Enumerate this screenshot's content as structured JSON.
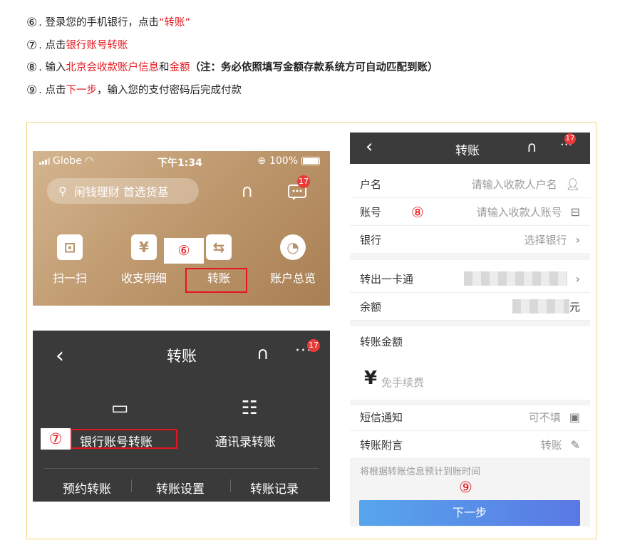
{
  "steps": [
    {
      "num": "⑥",
      "parts": [
        {
          "t": ". 登录您的手机银行，点击"
        },
        {
          "t": "“转账”",
          "red": true
        }
      ]
    },
    {
      "num": "⑦",
      "parts": [
        {
          "t": ". 点击"
        },
        {
          "t": "银行账号转账",
          "red": true
        }
      ]
    },
    {
      "num": "⑧",
      "parts": [
        {
          "t": ". 输入"
        },
        {
          "t": "北京会收款账户信息",
          "red": true
        },
        {
          "t": "和"
        },
        {
          "t": "金额",
          "red": true
        },
        {
          "t": "（注：务必依照填写金额存款系统方可自动匹配到账）",
          "bold": true
        }
      ]
    },
    {
      "num": "⑨",
      "parts": [
        {
          "t": ". 点击"
        },
        {
          "t": "下一步",
          "red": true
        },
        {
          "t": "，输入您的支付密码后完成付款"
        }
      ]
    }
  ],
  "screenA": {
    "carrier": "Globe",
    "time": "下午1:34",
    "battery": "100%",
    "battery_level": 1.0,
    "search_placeholder": "闲钱理财 首选货基",
    "badge": "17",
    "functions": [
      {
        "label": "扫一扫",
        "icon": "scan-icon"
      },
      {
        "label": "收支明细",
        "icon": "receipt-icon"
      },
      {
        "label": "转账",
        "icon": "transfer-icon"
      },
      {
        "label": "账户总览",
        "icon": "pie-chart-icon"
      }
    ],
    "annotation": "⑥"
  },
  "screenB": {
    "title": "转账",
    "badge": "17",
    "options": [
      {
        "label": "银行账号转账",
        "icon": "card-icon"
      },
      {
        "label": "通讯录转账",
        "icon": "contacts-icon"
      }
    ],
    "bottom": [
      "预约转账",
      "转账设置",
      "转账记录"
    ],
    "annotation": "⑦"
  },
  "screenC": {
    "title": "转账",
    "badge": "17",
    "fields": [
      {
        "label": "户名",
        "placeholder": "请输入收款人户名",
        "icon": "person-icon"
      },
      {
        "label": "账号",
        "placeholder": "请输入收款人账号",
        "icon": "scan-card-icon"
      },
      {
        "label": "银行",
        "placeholder": "选择银行",
        "icon": "chevron-right-icon"
      }
    ],
    "card_label": "转出一卡通",
    "balance_label": "余额",
    "balance_unit": "元",
    "amount_label": "转账金额",
    "currency": "¥",
    "amount_placeholder": "免手续费",
    "sms_label": "短信通知",
    "sms_value": "可不填",
    "note_label": "转账附言",
    "note_value": "转账",
    "hint": "将根据转账信息预计到账时间",
    "next": "下一步",
    "annotation8": "⑧",
    "annotation9": "⑨"
  }
}
